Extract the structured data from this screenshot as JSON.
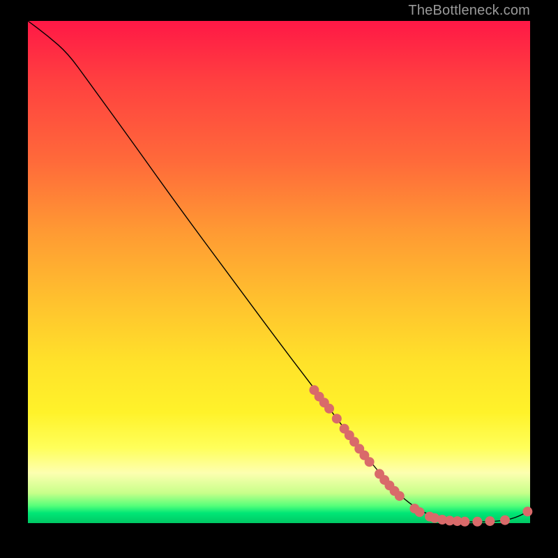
{
  "attribution": "TheBottleneck.com",
  "chart_data": {
    "type": "line",
    "title": "",
    "xlabel": "",
    "ylabel": "",
    "xlim": [
      0,
      100
    ],
    "ylim": [
      0,
      100
    ],
    "background_gradient_stops": [
      {
        "pos": 0,
        "color": "#ff1846"
      },
      {
        "pos": 12,
        "color": "#ff4040"
      },
      {
        "pos": 28,
        "color": "#ff6a3a"
      },
      {
        "pos": 42,
        "color": "#ff9a33"
      },
      {
        "pos": 56,
        "color": "#ffc22e"
      },
      {
        "pos": 68,
        "color": "#ffe22a"
      },
      {
        "pos": 78,
        "color": "#fff22a"
      },
      {
        "pos": 85,
        "color": "#ffff5a"
      },
      {
        "pos": 90,
        "color": "#fdffb0"
      },
      {
        "pos": 94,
        "color": "#c8ff8a"
      },
      {
        "pos": 97,
        "color": "#58ff7a"
      },
      {
        "pos": 100,
        "color": "#00c864"
      }
    ],
    "series": [
      {
        "name": "bottleneck-curve",
        "color": "#000000",
        "stroke_width": 1.4,
        "points": [
          {
            "x": 0,
            "y": 100
          },
          {
            "x": 4,
            "y": 97
          },
          {
            "x": 8,
            "y": 93.5
          },
          {
            "x": 12,
            "y": 88
          },
          {
            "x": 20,
            "y": 77
          },
          {
            "x": 30,
            "y": 63
          },
          {
            "x": 40,
            "y": 49.5
          },
          {
            "x": 50,
            "y": 36
          },
          {
            "x": 58,
            "y": 25.5
          },
          {
            "x": 64,
            "y": 17.5
          },
          {
            "x": 70,
            "y": 10
          },
          {
            "x": 74,
            "y": 5.5
          },
          {
            "x": 78,
            "y": 2.5
          },
          {
            "x": 82,
            "y": 0.8
          },
          {
            "x": 86,
            "y": 0.3
          },
          {
            "x": 90,
            "y": 0.2
          },
          {
            "x": 94,
            "y": 0.4
          },
          {
            "x": 97,
            "y": 1.0
          },
          {
            "x": 100,
            "y": 2.5
          }
        ]
      }
    ],
    "markers": {
      "name": "highlight-dots",
      "color": "#d96a6a",
      "radius": 7,
      "points": [
        {
          "x": 57,
          "y": 26.5
        },
        {
          "x": 58,
          "y": 25.2
        },
        {
          "x": 59,
          "y": 24.0
        },
        {
          "x": 60,
          "y": 22.8
        },
        {
          "x": 61.5,
          "y": 20.8
        },
        {
          "x": 63,
          "y": 18.8
        },
        {
          "x": 64,
          "y": 17.5
        },
        {
          "x": 65,
          "y": 16.2
        },
        {
          "x": 66,
          "y": 14.8
        },
        {
          "x": 67,
          "y": 13.5
        },
        {
          "x": 68,
          "y": 12.2
        },
        {
          "x": 70,
          "y": 9.8
        },
        {
          "x": 71,
          "y": 8.6
        },
        {
          "x": 72,
          "y": 7.5
        },
        {
          "x": 73,
          "y": 6.4
        },
        {
          "x": 74,
          "y": 5.4
        },
        {
          "x": 77,
          "y": 2.9
        },
        {
          "x": 78,
          "y": 2.2
        },
        {
          "x": 80,
          "y": 1.3
        },
        {
          "x": 81,
          "y": 1.0
        },
        {
          "x": 82.5,
          "y": 0.7
        },
        {
          "x": 84,
          "y": 0.5
        },
        {
          "x": 85.5,
          "y": 0.4
        },
        {
          "x": 87,
          "y": 0.3
        },
        {
          "x": 89.5,
          "y": 0.3
        },
        {
          "x": 92,
          "y": 0.4
        },
        {
          "x": 95,
          "y": 0.6
        },
        {
          "x": 99.5,
          "y": 2.3
        }
      ]
    }
  }
}
